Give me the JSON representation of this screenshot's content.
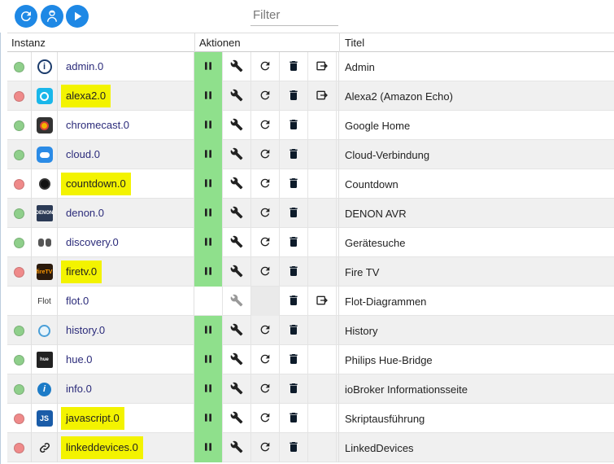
{
  "toolbar": {
    "filter_placeholder": "Filter",
    "icons": [
      "refresh-icon",
      "expert-mode-icon",
      "play-icon"
    ]
  },
  "columns": {
    "instance": "Instanz",
    "actions": "Aktionen",
    "title": "Titel"
  },
  "rows": [
    {
      "status": "green",
      "icon": "admin-icon",
      "name": "admin.0",
      "title": "Admin",
      "highlighted": false,
      "running": true,
      "restart": true,
      "link": true
    },
    {
      "status": "red",
      "icon": "alexa-icon",
      "name": "alexa2.0",
      "title": "Alexa2 (Amazon Echo)",
      "highlighted": true,
      "running": true,
      "restart": true,
      "link": true
    },
    {
      "status": "green",
      "icon": "chromecast-icon",
      "name": "chromecast.0",
      "title": "Google Home",
      "highlighted": false,
      "running": true,
      "restart": true,
      "link": false
    },
    {
      "status": "green",
      "icon": "cloud-icon",
      "name": "cloud.0",
      "title": "Cloud-Verbindung",
      "highlighted": false,
      "running": true,
      "restart": true,
      "link": false
    },
    {
      "status": "red",
      "icon": "alarm-clock-icon",
      "name": "countdown.0",
      "title": "Countdown",
      "highlighted": true,
      "running": true,
      "restart": true,
      "link": false
    },
    {
      "status": "green",
      "icon": "denon-icon",
      "name": "denon.0",
      "title": "DENON AVR",
      "highlighted": false,
      "running": true,
      "restart": true,
      "link": false
    },
    {
      "status": "green",
      "icon": "binoculars-icon",
      "name": "discovery.0",
      "title": "Gerätesuche",
      "highlighted": false,
      "running": true,
      "restart": true,
      "link": false
    },
    {
      "status": "red",
      "icon": "firetv-icon",
      "name": "firetv.0",
      "title": "Fire TV",
      "highlighted": true,
      "running": true,
      "restart": true,
      "link": false
    },
    {
      "status": "none",
      "icon": "flot-icon",
      "name": "flot.0",
      "title": "Flot-Diagrammen",
      "highlighted": false,
      "running": false,
      "restart": false,
      "link": true,
      "icon_text": "Flot"
    },
    {
      "status": "green",
      "icon": "history-icon",
      "name": "history.0",
      "title": "History",
      "highlighted": false,
      "running": true,
      "restart": true,
      "link": false
    },
    {
      "status": "green",
      "icon": "hue-icon",
      "name": "hue.0",
      "title": "Philips Hue-Bridge",
      "highlighted": false,
      "running": true,
      "restart": true,
      "link": false
    },
    {
      "status": "green",
      "icon": "info-icon",
      "name": "info.0",
      "title": "ioBroker Informationsseite",
      "highlighted": false,
      "running": true,
      "restart": true,
      "link": false
    },
    {
      "status": "red",
      "icon": "javascript-icon",
      "name": "javascript.0",
      "title": "Skriptausführung",
      "highlighted": true,
      "running": true,
      "restart": true,
      "link": false,
      "icon_text": "JS"
    },
    {
      "status": "red",
      "icon": "link-icon",
      "name": "linkeddevices.0",
      "title": "LinkedDevices",
      "highlighted": true,
      "running": true,
      "restart": true,
      "link": false
    }
  ],
  "colors": {
    "accent": "#1e88e5",
    "running": "#8fe08c",
    "status_green": "#8fcf8b",
    "status_red": "#ef8a8a",
    "highlight": "#f3f300"
  }
}
